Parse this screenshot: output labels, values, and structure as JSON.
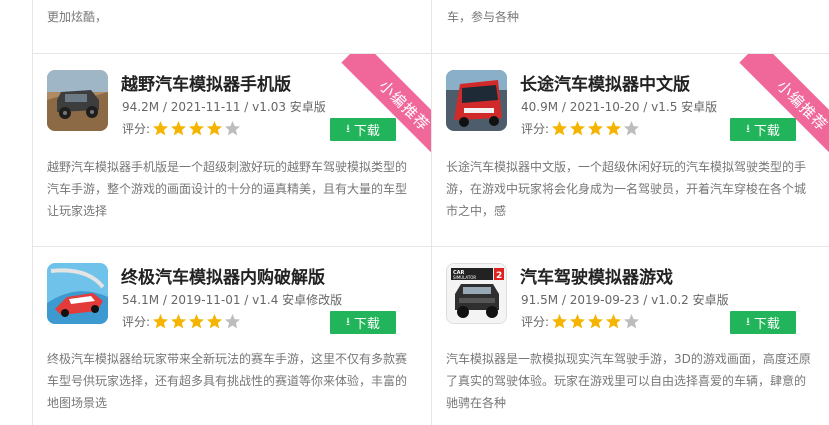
{
  "top_row": [
    {
      "desc_line1": "更加炫酷，",
      "desc_partial": ""
    },
    {
      "desc_line1": "车，参与各种",
      "desc_partial": ""
    }
  ],
  "badge_text": "小编推荐",
  "rating_label": "评分:",
  "download_label": "下载",
  "apps": [
    {
      "title": "越野汽车模拟器手机版",
      "meta": "94.2M / 2021-11-11 / v1.03 安卓版",
      "rating_stars": 4,
      "rating_max": 5,
      "recommended": true,
      "icon": "offroad-car-icon",
      "desc_lines": [
        "越野汽车模拟器手机版是一个超级刺激好玩的越野车驾驶模拟类型的",
        "汽车手游，整个游戏的画面设计的十分的逼真精美，且有大量的车型",
        "让玩家选择"
      ]
    },
    {
      "title": "长途汽车模拟器中文版",
      "meta": "40.9M / 2021-10-20 / v1.5 安卓版",
      "rating_stars": 4,
      "rating_max": 5,
      "recommended": true,
      "icon": "bus-icon",
      "desc_lines": [
        "长途汽车模拟器中文版，一个超级休闲好玩的汽车模拟驾驶类型的手",
        "游，在游戏中玩家将会化身成为一名驾驶员，开着汽车穿梭在各个城",
        "市之中，感"
      ]
    },
    {
      "title": "终极汽车模拟器内购破解版",
      "meta": "54.1M / 2019-11-01 / v1.4 安卓修改版",
      "rating_stars": 4,
      "rating_max": 5,
      "recommended": false,
      "icon": "race-car-icon",
      "desc_lines": [
        "终极汽车模拟器给玩家带来全新玩法的赛车手游，这里不仅有多款赛",
        "车型号供玩家选择，还有超多具有挑战性的赛道等你来体验，丰富的",
        "地图场景选"
      ]
    },
    {
      "title": "汽车驾驶模拟器游戏",
      "meta": "91.5M / 2019-09-23 / v1.0.2 安卓版",
      "rating_stars": 4,
      "rating_max": 5,
      "recommended": false,
      "icon": "car-simulator-2-icon",
      "icon_text": "CAR SIMULATOR 2",
      "desc_lines": [
        "汽车模拟器是一款模拟现实汽车驾驶手游，3D的游戏画面，高度还原",
        "了真实的驾驶体验。玩家在游戏里可以自由选择喜爱的车辆，肆意的",
        "驰骋在各种"
      ]
    }
  ],
  "colors": {
    "download_green": "#21b45a",
    "ribbon_pink": "#f0679a",
    "star_gold": "#f5b400",
    "star_gray": "#bdbdbd"
  }
}
